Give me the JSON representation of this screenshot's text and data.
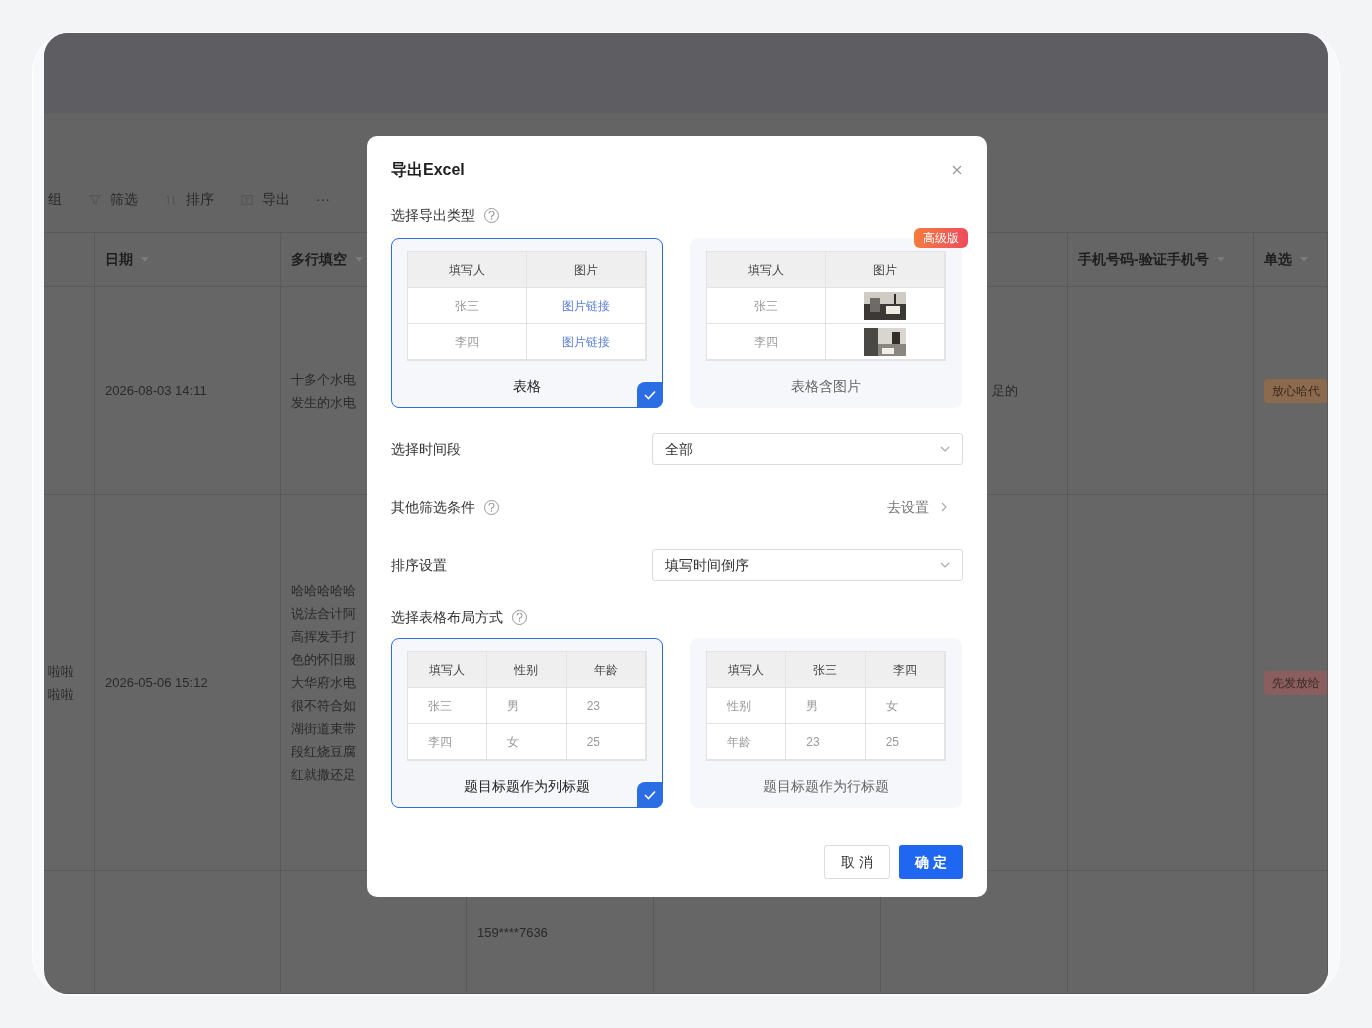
{
  "toolbar": [
    {
      "kind": "text",
      "label": "组"
    },
    {
      "kind": "filter",
      "label": "筛选"
    },
    {
      "kind": "sort",
      "label": "排序"
    },
    {
      "kind": "export",
      "label": "导出"
    },
    {
      "kind": "text",
      "label": "···"
    }
  ],
  "table": {
    "columns": [
      {},
      {
        "label": "日期"
      },
      {
        "label": "多行填空"
      },
      {},
      {},
      {},
      {
        "label": "手机号码-验证手机号"
      },
      {
        "label": "单选"
      }
    ],
    "rows": [
      {
        "cells": [
          {
            "kind": "empty"
          },
          {
            "kind": "text",
            "lines": [
              "2026-08-03 14:11"
            ]
          },
          {
            "kind": "text",
            "lines": [
              "十多个水电",
              "发生的水电"
            ]
          },
          {
            "kind": "empty"
          },
          {
            "kind": "empty"
          },
          {
            "kind": "text",
            "lines": [
              "足的"
            ]
          },
          {
            "kind": "empty"
          },
          {
            "kind": "tag",
            "label": "放心哈代",
            "color": "#8c6a4e"
          }
        ]
      },
      {
        "cells": [
          {
            "kind": "text",
            "lines": [
              "啦啦",
              "啦啦"
            ]
          },
          {
            "kind": "text",
            "lines": [
              "2026-05-06 15:12"
            ]
          },
          {
            "kind": "text",
            "lines": [
              "哈哈哈哈哈",
              "说法合计阿",
              "高挥发手打",
              "色的怀旧服",
              "大华府水电",
              "很不符合如",
              "湖街道束带",
              "段红烧豆腐",
              "红就撒还足"
            ]
          },
          {
            "kind": "empty"
          },
          {
            "kind": "empty"
          },
          {
            "kind": "empty"
          },
          {
            "kind": "empty"
          },
          {
            "kind": "tag",
            "label": "先发放给",
            "color": "#8a5e5e"
          }
        ]
      },
      {
        "cells": [
          {
            "kind": "empty"
          },
          {
            "kind": "empty"
          },
          {
            "kind": "empty"
          },
          {
            "kind": "text",
            "lines": [
              "159****7636"
            ]
          },
          {
            "kind": "empty"
          },
          {
            "kind": "empty"
          },
          {
            "kind": "empty"
          },
          {
            "kind": "empty"
          }
        ]
      }
    ]
  },
  "dialog": {
    "title": "导出Excel",
    "export_type": {
      "label": "选择导出类型",
      "options": [
        {
          "label": "表格",
          "selected": true,
          "header": [
            "填写人",
            "图片"
          ],
          "rows": [
            [
              {
                "kind": "text",
                "text": "张三"
              },
              {
                "kind": "link",
                "text": "图片链接"
              }
            ],
            [
              {
                "kind": "text",
                "text": "李四"
              },
              {
                "kind": "link",
                "text": "图片链接"
              }
            ]
          ]
        },
        {
          "label": "表格含图片",
          "selected": false,
          "badge": "高级版",
          "header": [
            "填写人",
            "图片"
          ],
          "rows": [
            [
              {
                "kind": "text",
                "text": "张三"
              },
              {
                "kind": "picture"
              }
            ],
            [
              {
                "kind": "text",
                "text": "李四"
              },
              {
                "kind": "picture"
              }
            ]
          ]
        }
      ]
    },
    "fields": [
      {
        "kind": "select",
        "label": "选择时间段",
        "value": "全部"
      },
      {
        "kind": "link",
        "label": "其他筛选条件",
        "help": true,
        "value": "去设置"
      },
      {
        "kind": "select",
        "label": "排序设置",
        "value": "填写时间倒序"
      }
    ],
    "layout": {
      "label": "选择表格布局方式",
      "options": [
        {
          "label": "题目标题作为列标题",
          "selected": true,
          "header": [
            "填写人",
            "性别",
            "年龄"
          ],
          "rows": [
            [
              {
                "kind": "text",
                "text": "张三"
              },
              {
                "kind": "text",
                "text": "男"
              },
              {
                "kind": "text",
                "text": "23"
              }
            ],
            [
              {
                "kind": "text",
                "text": "李四"
              },
              {
                "kind": "text",
                "text": "女"
              },
              {
                "kind": "text",
                "text": "25"
              }
            ]
          ]
        },
        {
          "label": "题目标题作为行标题",
          "selected": false,
          "header": [
            "填写人",
            "张三",
            "李四"
          ],
          "rows": [
            [
              {
                "kind": "text",
                "text": "性别"
              },
              {
                "kind": "text",
                "text": "男"
              },
              {
                "kind": "text",
                "text": "女"
              }
            ],
            [
              {
                "kind": "text",
                "text": "年龄"
              },
              {
                "kind": "text",
                "text": "23"
              },
              {
                "kind": "text",
                "text": "25"
              }
            ]
          ]
        }
      ]
    },
    "buttons": [
      {
        "kind": "secondary",
        "label": "取 消"
      },
      {
        "kind": "primary",
        "label": "确 定"
      }
    ]
  }
}
